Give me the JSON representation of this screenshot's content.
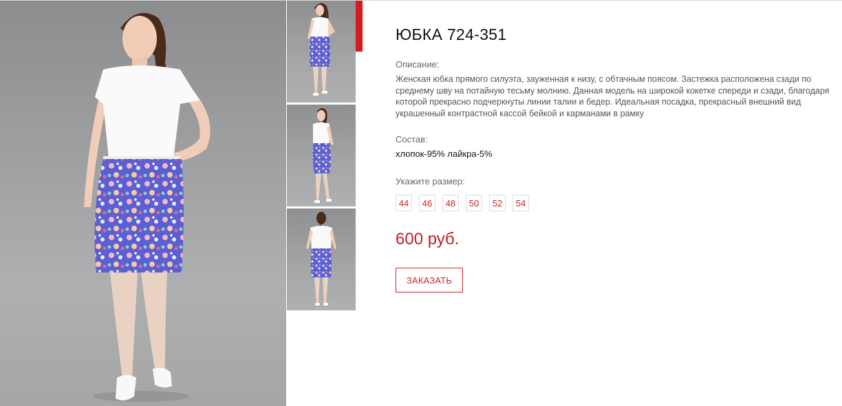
{
  "product": {
    "title": "ЮБКА 724-351",
    "description_label": "Описание:",
    "description": "Женская юбка прямого силуэта, зауженная к низу, с обтачным поясом. Застежка расположена сзади по среднему шву на потайную тесьму молнию. Данная модель на широкой кокетке спереди и сзади, благодаря которой прекрасно подчеркнуты линии талии и бедер. Идеальная посадка, прекрасный внешний вид украшенный контрастной кассой бейкой и карманами в рамку",
    "composition_label": "Состав:",
    "composition": "хлопок-95% лайкра-5%",
    "size_label": "Укажите размер:",
    "sizes": [
      "44",
      "46",
      "48",
      "50",
      "52",
      "54"
    ],
    "price": "600 руб.",
    "order_button": "ЗАКАЗАТЬ"
  },
  "gallery": {
    "main_image": "model-front-photo",
    "thumbnails": [
      "model-front-thumbnail",
      "model-side-thumbnail",
      "model-back-thumbnail"
    ]
  },
  "colors": {
    "accent": "#d71920",
    "price": "#c01f25",
    "photo_background": "#a2a3a5"
  }
}
